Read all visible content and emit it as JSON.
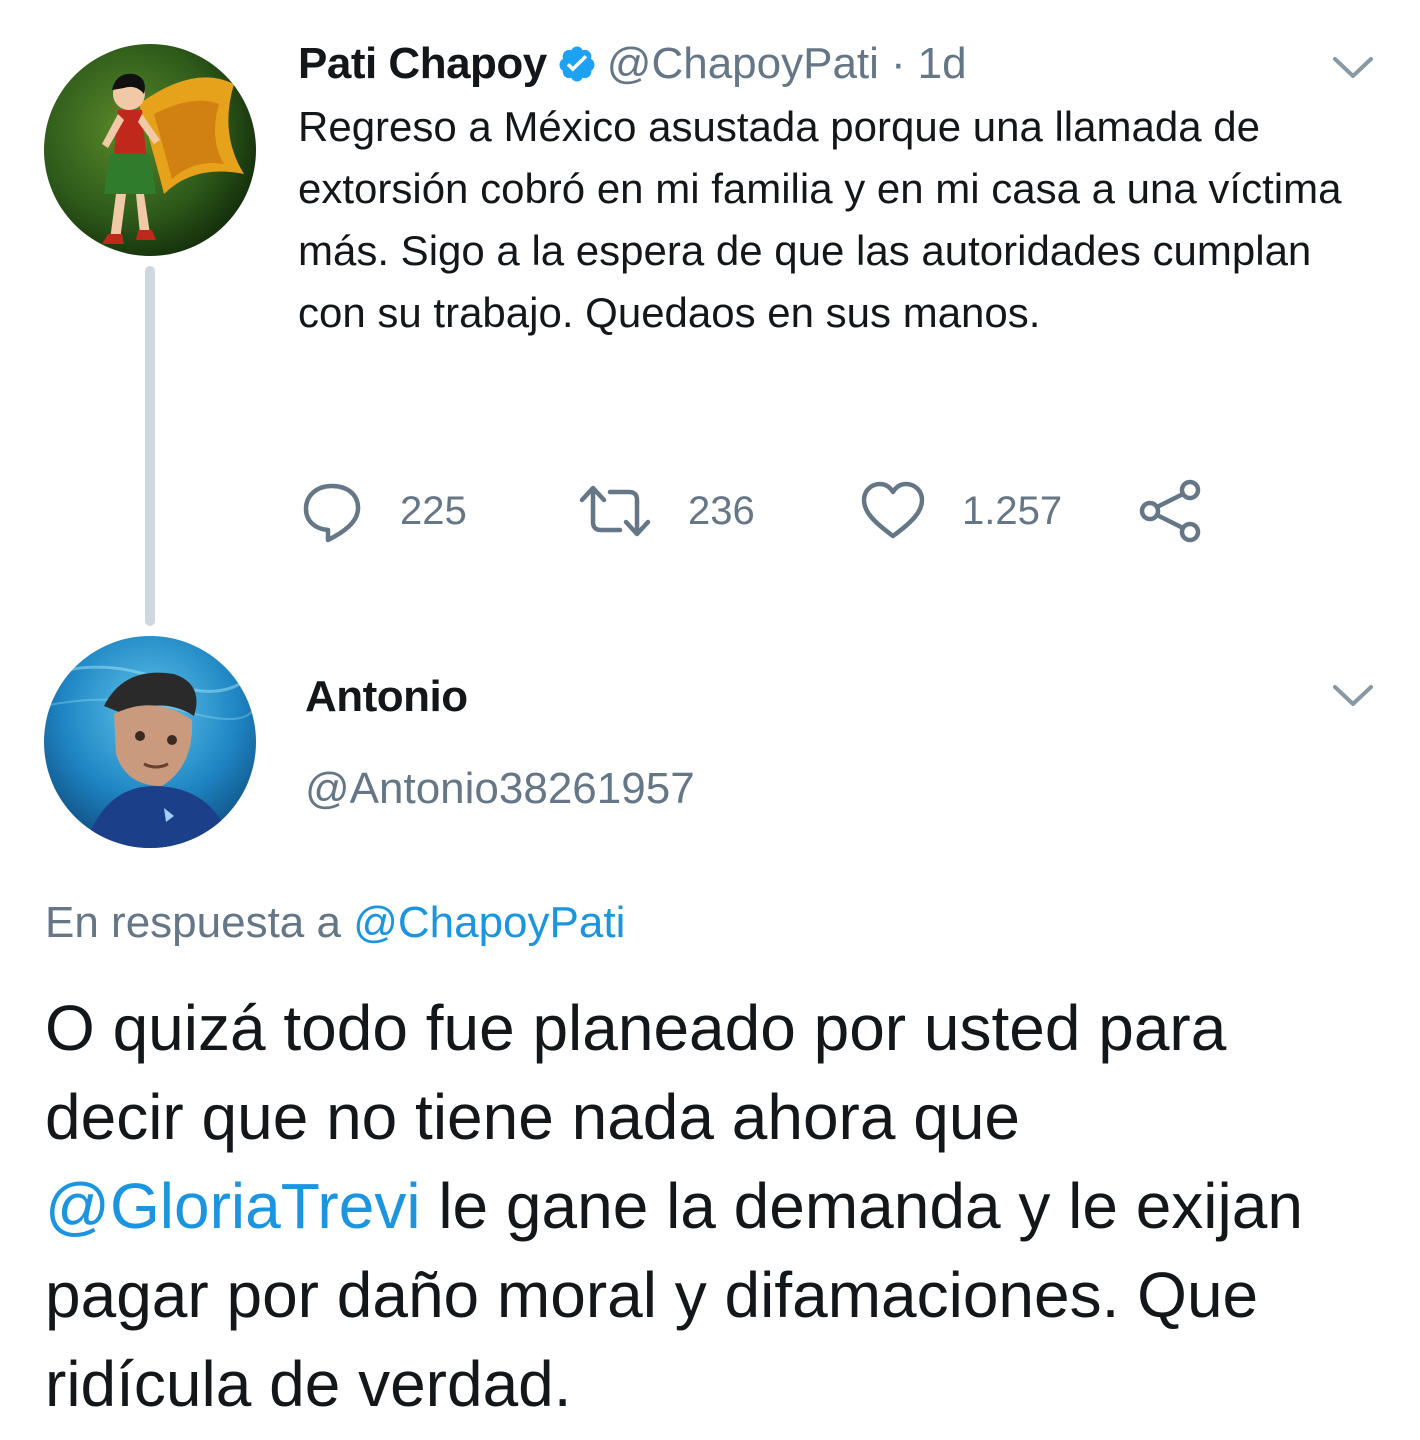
{
  "tweet": {
    "author_name": "Pati Chapoy",
    "verified_icon": "verified-badge-icon",
    "handle": "@ChapoyPati",
    "separator": "·",
    "time": "1d",
    "text": "Regreso a México asustada porque una llamada de extorsión cobró en mi familia y en mi casa a una víctima más. Sigo a la espera de que las autoridades cumplan con su trabajo. Quedaos en sus manos.",
    "actions": {
      "replies": "225",
      "retweets": "236",
      "likes": "1.257"
    }
  },
  "reply": {
    "author_name": "Antonio",
    "handle": "@Antonio38261957",
    "reply_prefix": "En respuesta a",
    "reply_to": "@ChapoyPati",
    "text_part1": "O quizá todo fue planeado por usted para decir que no tiene nada ahora que",
    "mention": "@GloriaTrevi",
    "text_part2": "le gane la demanda y le exijan pagar por daño moral y difamaciones. Que ridícula de verdad."
  },
  "colors": {
    "text": "#14171a",
    "muted": "#657786",
    "link": "#1b95e0",
    "verified": "#1da1f2",
    "thread_line": "#cfd8de"
  }
}
